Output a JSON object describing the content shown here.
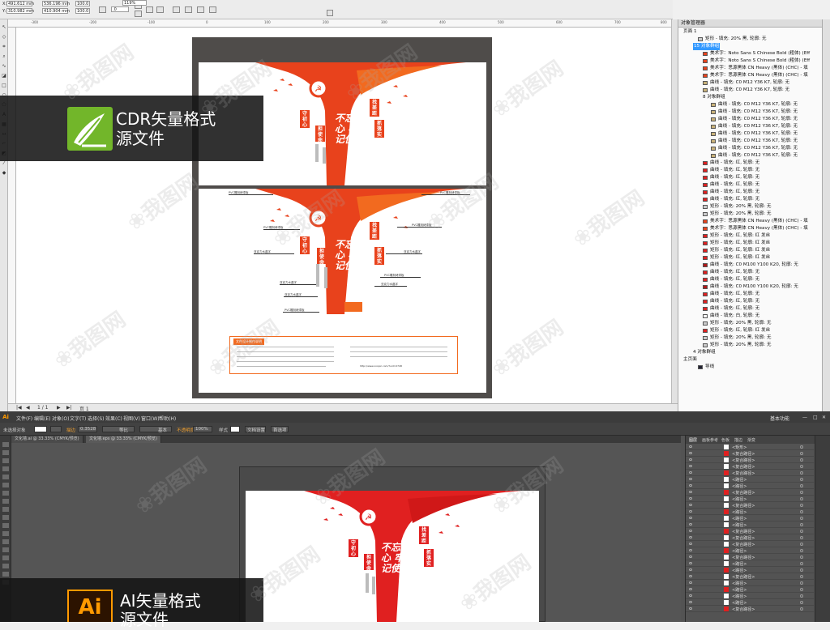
{
  "cdr": {
    "props": {
      "x": "491.612 mm",
      "y": "310.982 mm",
      "w": "536.196 mm",
      "h": "410.904 mm",
      "scale_x": "100.0",
      "scale_y": "100.0",
      "angle": ".0",
      "zoom": "119%"
    },
    "ruler_ticks": [
      "-300",
      "-200",
      "-100",
      "0",
      "100",
      "200",
      "300",
      "400",
      "500",
      "600",
      "700",
      "800"
    ],
    "status": {
      "page_nav": "1 / 1",
      "page_label": "页 1"
    },
    "callouts": [
      "PVC雕刻烤漆板",
      "PVC雕刻烤漆板",
      "PVC雕刻烤漆板",
      "亚克力水晶字",
      "PVC雕刻烤漆板",
      "亚克力水晶字",
      "PVC雕刻烤漆板",
      "亚克力水晶字",
      "亚克力水晶字",
      "亚克力水晶字",
      "PVC雕刻烤漆板"
    ],
    "artwork_labels": {
      "main_calligraphy": "不忘初心 牢记使命",
      "tag_left": "守初心",
      "tag_mid": "担使命",
      "tag_right1": "找差距",
      "tag_right2": "抓落实"
    },
    "spec_title": "文件设计制作说明",
    "spec_url": "http://www.ooopic.com/?uid=2748",
    "object_manager": {
      "title": "对象管理器",
      "rows": [
        {
          "indent": 6,
          "text": "页面 1",
          "swatch": null,
          "sel": false
        },
        {
          "indent": 24,
          "text": "矩形 - 填充: 20% 黑, 轮廓: 无",
          "swatch": "#ccc",
          "sel": false
        },
        {
          "indent": 18,
          "text": "15 对象群组",
          "swatch": null,
          "sel": true
        },
        {
          "indent": 30,
          "text": "美术字：Noto Sans S Chinese Bold (粗体) (Eff",
          "swatch": "#e8421c",
          "sel": false
        },
        {
          "indent": 30,
          "text": "美术字：Noto Sans S Chinese Bold (粗体) (Eff",
          "swatch": "#e8421c",
          "sel": false
        },
        {
          "indent": 30,
          "text": "美术字：思源黑体 CN Heavy (黑体) (CHC) - 填",
          "swatch": "#e8421c",
          "sel": false
        },
        {
          "indent": 30,
          "text": "美术字：思源黑体 CN Heavy (黑体) (CHC) - 填",
          "swatch": "#e8421c",
          "sel": false
        },
        {
          "indent": 30,
          "text": "曲线 - 填充: C0 M12 Y36 K7, 轮廓: 无",
          "swatch": "#c9b27a",
          "sel": false
        },
        {
          "indent": 30,
          "text": "曲线 - 填充: C0 M12 Y36 K7, 轮廓: 无",
          "swatch": "#c9b27a",
          "sel": false
        },
        {
          "indent": 30,
          "text": "8 对象群组",
          "swatch": null,
          "sel": false
        },
        {
          "indent": 40,
          "text": "曲线 - 填充: C0 M12 Y36 K7, 轮廓: 无",
          "swatch": "#c9b27a",
          "sel": false
        },
        {
          "indent": 40,
          "text": "曲线 - 填充: C0 M12 Y36 K7, 轮廓: 无",
          "swatch": "#c9b27a",
          "sel": false
        },
        {
          "indent": 40,
          "text": "曲线 - 填充: C0 M12 Y36 K7, 轮廓: 无",
          "swatch": "#c9b27a",
          "sel": false
        },
        {
          "indent": 40,
          "text": "曲线 - 填充: C0 M12 Y36 K7, 轮廓: 无",
          "swatch": "#c9b27a",
          "sel": false
        },
        {
          "indent": 40,
          "text": "曲线 - 填充: C0 M12 Y36 K7, 轮廓: 无",
          "swatch": "#c9b27a",
          "sel": false
        },
        {
          "indent": 40,
          "text": "曲线 - 填充: C0 M12 Y36 K7, 轮廓: 无",
          "swatch": "#c9b27a",
          "sel": false
        },
        {
          "indent": 40,
          "text": "曲线 - 填充: C0 M12 Y36 K7, 轮廓: 无",
          "swatch": "#c9b27a",
          "sel": false
        },
        {
          "indent": 40,
          "text": "曲线 - 填充: C0 M12 Y36 K7, 轮廓: 无",
          "swatch": "#c9b27a",
          "sel": false
        },
        {
          "indent": 30,
          "text": "曲线 - 填充: 红, 轮廓: 无",
          "swatch": "#e02020",
          "sel": false
        },
        {
          "indent": 30,
          "text": "曲线 - 填充: 红, 轮廓: 无",
          "swatch": "#e02020",
          "sel": false
        },
        {
          "indent": 30,
          "text": "曲线 - 填充: 红, 轮廓: 无",
          "swatch": "#e02020",
          "sel": false
        },
        {
          "indent": 30,
          "text": "曲线 - 填充: 红, 轮廓: 无",
          "swatch": "#e02020",
          "sel": false
        },
        {
          "indent": 30,
          "text": "曲线 - 填充: 红, 轮廓: 无",
          "swatch": "#e02020",
          "sel": false
        },
        {
          "indent": 30,
          "text": "曲线 - 填充: 红, 轮廓: 无",
          "swatch": "#e02020",
          "sel": false
        },
        {
          "indent": 30,
          "text": "矩形 - 填充: 20% 黑, 轮廓: 无",
          "swatch": "#ccc",
          "sel": false
        },
        {
          "indent": 30,
          "text": "矩形 - 填充: 20% 黑, 轮廓: 无",
          "swatch": "#ccc",
          "sel": false
        },
        {
          "indent": 30,
          "text": "美术字：思源黑体 CN Heavy (黑体) (CHC) - 填",
          "swatch": "#e8421c",
          "sel": false
        },
        {
          "indent": 30,
          "text": "美术字：思源黑体 CN Heavy (黑体) (CHC) - 填",
          "swatch": "#e8421c",
          "sel": false
        },
        {
          "indent": 30,
          "text": "矩形 - 填充: 红, 轮廓: 红 发丝",
          "swatch": "#e02020",
          "sel": false
        },
        {
          "indent": 30,
          "text": "矩形 - 填充: 红, 轮廓: 红 发丝",
          "swatch": "#e02020",
          "sel": false
        },
        {
          "indent": 30,
          "text": "矩形 - 填充: 红, 轮廓: 红 发丝",
          "swatch": "#e02020",
          "sel": false
        },
        {
          "indent": 30,
          "text": "矩形 - 填充: 红, 轮廓: 红 发丝",
          "swatch": "#e02020",
          "sel": false
        },
        {
          "indent": 30,
          "text": "曲线 - 填充: C0 M100 Y100 K20, 轮廓: 无",
          "swatch": "#b01818",
          "sel": false
        },
        {
          "indent": 30,
          "text": "曲线 - 填充: 红, 轮廓: 无",
          "swatch": "#e02020",
          "sel": false
        },
        {
          "indent": 30,
          "text": "曲线 - 填充: 红, 轮廓: 无",
          "swatch": "#e02020",
          "sel": false
        },
        {
          "indent": 30,
          "text": "曲线 - 填充: C0 M100 Y100 K20, 轮廓: 无",
          "swatch": "#b01818",
          "sel": false
        },
        {
          "indent": 30,
          "text": "曲线 - 填充: 红, 轮廓: 无",
          "swatch": "#e02020",
          "sel": false
        },
        {
          "indent": 30,
          "text": "曲线 - 填充: 红, 轮廓: 无",
          "swatch": "#e02020",
          "sel": false
        },
        {
          "indent": 30,
          "text": "曲线 - 填充: 红, 轮廓: 无",
          "swatch": "#e02020",
          "sel": false
        },
        {
          "indent": 30,
          "text": "曲线 - 填充: 白, 轮廓: 无",
          "swatch": "#fff",
          "sel": false
        },
        {
          "indent": 30,
          "text": "矩形 - 填充: 20% 黑, 轮廓: 无",
          "swatch": "#ccc",
          "sel": false
        },
        {
          "indent": 30,
          "text": "矩形 - 填充: 红, 轮廓: 红 发丝",
          "swatch": "#e02020",
          "sel": false
        },
        {
          "indent": 30,
          "text": "矩形 - 填充: 20% 黑, 轮廓: 无",
          "swatch": "#ccc",
          "sel": false
        },
        {
          "indent": 30,
          "text": "矩形 - 填充: 20% 黑, 轮廓: 无",
          "swatch": "#ccc",
          "sel": false
        },
        {
          "indent": 18,
          "text": "4 对象群组",
          "swatch": null,
          "sel": false
        },
        {
          "indent": 6,
          "text": "主页面",
          "swatch": null,
          "sel": false
        },
        {
          "indent": 24,
          "text": "导线",
          "swatch": "#223",
          "sel": false
        }
      ]
    }
  },
  "overlays": {
    "cdr_text_line1": "CDR矢量格式",
    "cdr_text_line2": "源文件",
    "ai_text_line1": "AI矢量格式",
    "ai_text_line2": "源文件",
    "ai_logo": "Ai"
  },
  "ai": {
    "menu": [
      "文件(F)",
      "编辑(E)",
      "对象(O)",
      "文字(T)",
      "选择(S)",
      "效果(C)",
      "视图(V)",
      "窗口(W)",
      "帮助(H)"
    ],
    "workspace": "基本功能",
    "control": {
      "selection": "未选择对象",
      "stroke": "0.3528",
      "stroke_style1": "等比",
      "stroke_style2": "基本",
      "opacity_label": "不透明度",
      "opacity": "100%",
      "style_label": "样式",
      "doc_setup": "文档设置",
      "prefs": "首选项"
    },
    "tabs": [
      "文化墙.ai @ 33.33% (CMYK/预览)",
      "文化墙.eps @ 33.33% (CMYK/预览)"
    ],
    "panel_tabs": [
      "图层",
      "画板参考",
      "色板",
      "描边",
      "渐变"
    ],
    "layers": [
      "<矩形>",
      "<复合路径>",
      "<复合路径>",
      "<复合路径>",
      "<复合路径>",
      "<路径>",
      "<路径>",
      "<复合路径>",
      "<路径>",
      "<复合路径>",
      "<路径>",
      "<路径>",
      "<路径>",
      "<复合路径>",
      "<复合路径>",
      "<复合路径>",
      "<路径>",
      "<复合路径>",
      "<路径>",
      "<路径>",
      "<复合路径>",
      "<路径>",
      "<路径>",
      "<路径>",
      "<路径>",
      "<复合路径>"
    ]
  }
}
